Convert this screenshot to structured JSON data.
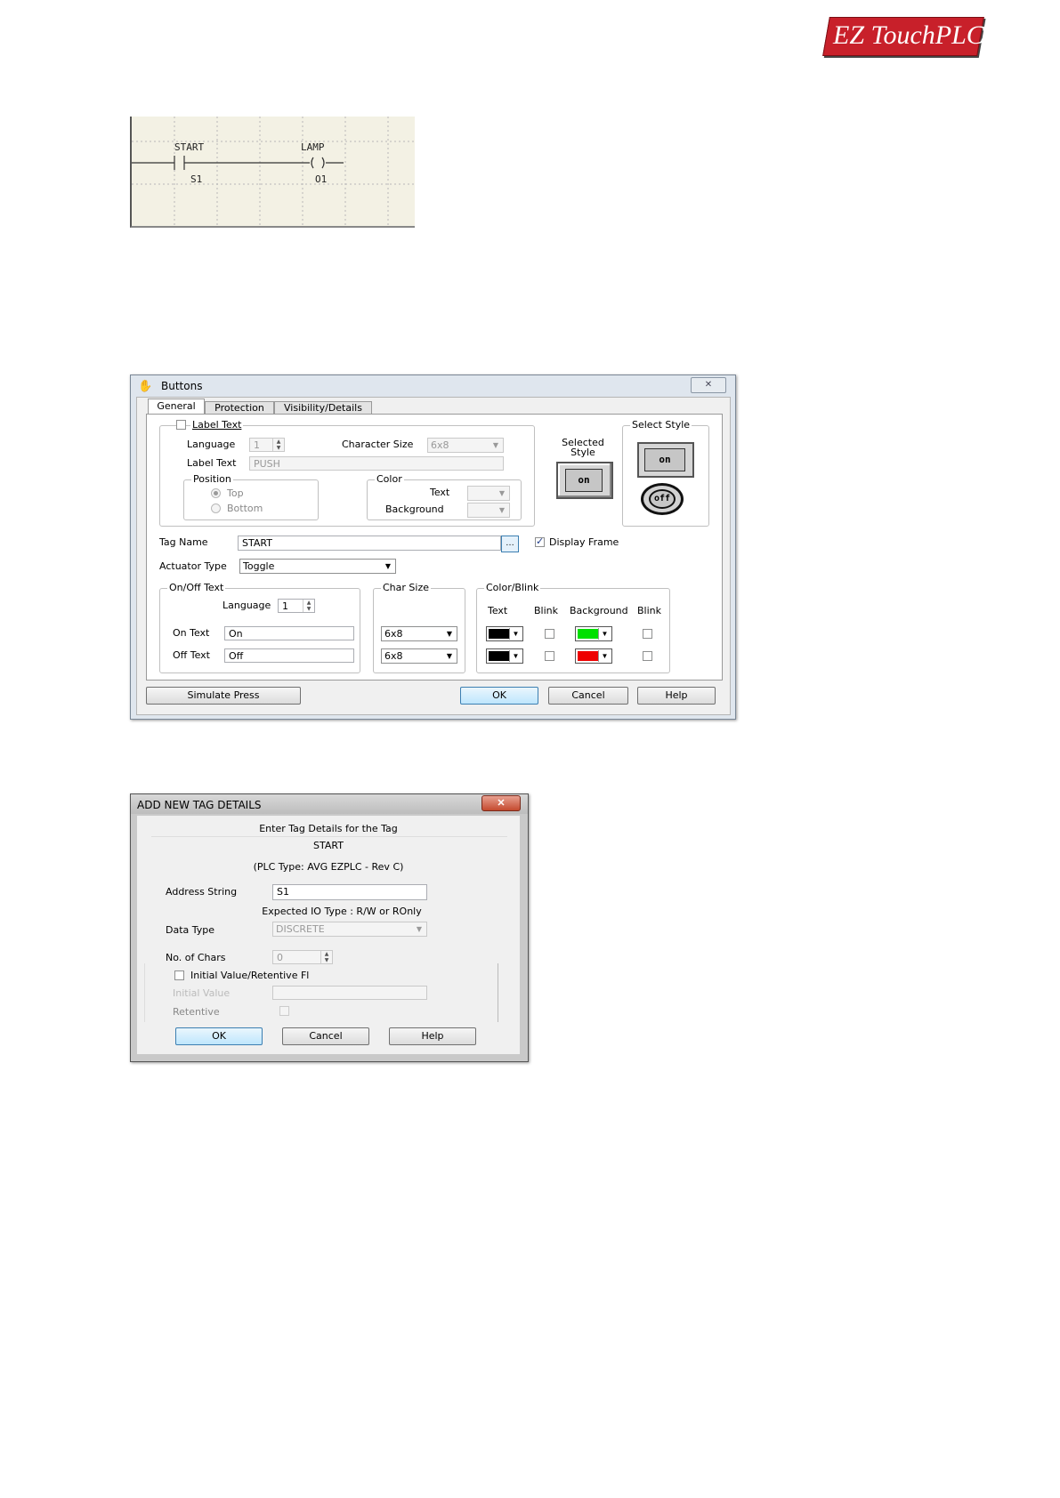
{
  "logo": {
    "text": "EZ TouchPLC",
    "color": "#c8202a"
  },
  "ladder": {
    "contact_name": "START",
    "contact_address": "S1",
    "coil_name": "LAMP",
    "coil_address": "O1"
  },
  "buttons_dialog": {
    "title": "Buttons",
    "close_symbol": "✕",
    "tabs": [
      "General",
      "Protection",
      "Visibility/Details"
    ],
    "label_text_check": "Label Text",
    "language_label": "Language",
    "language_value": "1",
    "char_size_label": "Character Size",
    "char_size_value": "6x8",
    "label_text_label": "Label Text",
    "label_text_value": "PUSH",
    "position_group": "Position",
    "position_top": "Top",
    "position_bottom": "Bottom",
    "color_group": "Color",
    "color_text": "Text",
    "color_background": "Background",
    "selected_style_label": "Selected Style",
    "select_style_group": "Select Style",
    "style_on": "on",
    "style_off": "off",
    "tag_name_label": "Tag Name",
    "tag_name_value": "START",
    "display_frame": "Display Frame",
    "actuator_type_label": "Actuator Type",
    "actuator_type_value": "Toggle",
    "onoff_group": "On/Off Text",
    "onoff_language_label": "Language",
    "onoff_language_value": "1",
    "on_text_label": "On Text",
    "on_text_value": "On",
    "off_text_label": "Off Text",
    "off_text_value": "Off",
    "char_size_group": "Char Size",
    "on_char_size": "6x8",
    "off_char_size": "6x8",
    "color_blink_group": "Color/Blink",
    "cb_text": "Text",
    "cb_blink": "Blink",
    "cb_background": "Background",
    "cb_blink2": "Blink",
    "on_text_color": "#000000",
    "on_bg_color": "#00e000",
    "off_text_color": "#000000",
    "off_bg_color": "#ee0000",
    "simulate_button": "Simulate Press",
    "ok_button": "OK",
    "cancel_button": "Cancel",
    "help_button": "Help"
  },
  "tag_dialog": {
    "title": "ADD NEW TAG DETAILS",
    "close_symbol": "✕",
    "heading": "Enter Tag Details for the Tag",
    "tag": "START",
    "plc_type": "(PLC Type: AVG EZPLC - Rev C)",
    "address_label": "Address String",
    "address_value": "S1",
    "expected_io": "Expected IO Type : R/W or ROnly",
    "data_type_label": "Data Type",
    "data_type_value": "DISCRETE",
    "no_chars_label": "No. of Chars",
    "no_chars_value": "0",
    "initial_retentive": "Initial Value/Retentive Fl",
    "initial_value_label": "Initial Value",
    "retentive_label": "Retentive",
    "ok_button": "OK",
    "cancel_button": "Cancel",
    "help_button": "Help"
  }
}
